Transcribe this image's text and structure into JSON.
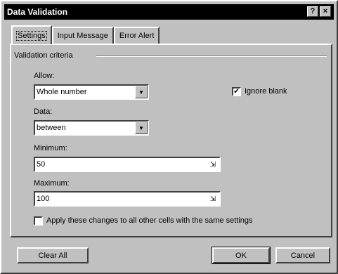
{
  "window": {
    "title": "Data Validation",
    "help_icon": "help-icon",
    "close_icon": "close-icon"
  },
  "tabs": [
    {
      "label": "Settings",
      "active": true
    },
    {
      "label": "Input Message",
      "active": false
    },
    {
      "label": "Error Alert",
      "active": false
    }
  ],
  "settings": {
    "group_label": "Validation criteria",
    "allow_label": "Allow:",
    "allow_value": "Whole number",
    "ignore_blank_label": "Ignore blank",
    "ignore_blank_checked": true,
    "data_label": "Data:",
    "data_value": "between",
    "minimum_label": "Minimum:",
    "minimum_value": "50",
    "maximum_label": "Maximum:",
    "maximum_value": "100",
    "apply_label": "Apply these changes to all other cells with the same settings",
    "apply_checked": false
  },
  "buttons": {
    "clear_all": "Clear All",
    "ok": "OK",
    "cancel": "Cancel"
  }
}
